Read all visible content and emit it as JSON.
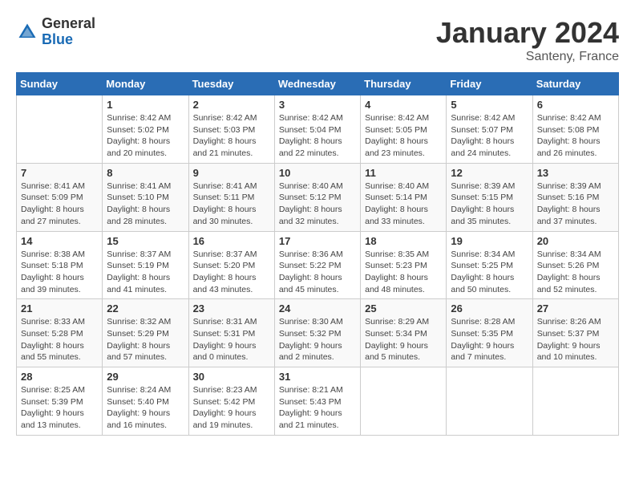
{
  "logo": {
    "general": "General",
    "blue": "Blue"
  },
  "title": "January 2024",
  "subtitle": "Santeny, France",
  "days_of_week": [
    "Sunday",
    "Monday",
    "Tuesday",
    "Wednesday",
    "Thursday",
    "Friday",
    "Saturday"
  ],
  "weeks": [
    [
      {
        "day": "",
        "sunrise": "",
        "sunset": "",
        "daylight": ""
      },
      {
        "day": "1",
        "sunrise": "Sunrise: 8:42 AM",
        "sunset": "Sunset: 5:02 PM",
        "daylight": "Daylight: 8 hours and 20 minutes."
      },
      {
        "day": "2",
        "sunrise": "Sunrise: 8:42 AM",
        "sunset": "Sunset: 5:03 PM",
        "daylight": "Daylight: 8 hours and 21 minutes."
      },
      {
        "day": "3",
        "sunrise": "Sunrise: 8:42 AM",
        "sunset": "Sunset: 5:04 PM",
        "daylight": "Daylight: 8 hours and 22 minutes."
      },
      {
        "day": "4",
        "sunrise": "Sunrise: 8:42 AM",
        "sunset": "Sunset: 5:05 PM",
        "daylight": "Daylight: 8 hours and 23 minutes."
      },
      {
        "day": "5",
        "sunrise": "Sunrise: 8:42 AM",
        "sunset": "Sunset: 5:07 PM",
        "daylight": "Daylight: 8 hours and 24 minutes."
      },
      {
        "day": "6",
        "sunrise": "Sunrise: 8:42 AM",
        "sunset": "Sunset: 5:08 PM",
        "daylight": "Daylight: 8 hours and 26 minutes."
      }
    ],
    [
      {
        "day": "7",
        "sunrise": "Sunrise: 8:41 AM",
        "sunset": "Sunset: 5:09 PM",
        "daylight": "Daylight: 8 hours and 27 minutes."
      },
      {
        "day": "8",
        "sunrise": "Sunrise: 8:41 AM",
        "sunset": "Sunset: 5:10 PM",
        "daylight": "Daylight: 8 hours and 28 minutes."
      },
      {
        "day": "9",
        "sunrise": "Sunrise: 8:41 AM",
        "sunset": "Sunset: 5:11 PM",
        "daylight": "Daylight: 8 hours and 30 minutes."
      },
      {
        "day": "10",
        "sunrise": "Sunrise: 8:40 AM",
        "sunset": "Sunset: 5:12 PM",
        "daylight": "Daylight: 8 hours and 32 minutes."
      },
      {
        "day": "11",
        "sunrise": "Sunrise: 8:40 AM",
        "sunset": "Sunset: 5:14 PM",
        "daylight": "Daylight: 8 hours and 33 minutes."
      },
      {
        "day": "12",
        "sunrise": "Sunrise: 8:39 AM",
        "sunset": "Sunset: 5:15 PM",
        "daylight": "Daylight: 8 hours and 35 minutes."
      },
      {
        "day": "13",
        "sunrise": "Sunrise: 8:39 AM",
        "sunset": "Sunset: 5:16 PM",
        "daylight": "Daylight: 8 hours and 37 minutes."
      }
    ],
    [
      {
        "day": "14",
        "sunrise": "Sunrise: 8:38 AM",
        "sunset": "Sunset: 5:18 PM",
        "daylight": "Daylight: 8 hours and 39 minutes."
      },
      {
        "day": "15",
        "sunrise": "Sunrise: 8:37 AM",
        "sunset": "Sunset: 5:19 PM",
        "daylight": "Daylight: 8 hours and 41 minutes."
      },
      {
        "day": "16",
        "sunrise": "Sunrise: 8:37 AM",
        "sunset": "Sunset: 5:20 PM",
        "daylight": "Daylight: 8 hours and 43 minutes."
      },
      {
        "day": "17",
        "sunrise": "Sunrise: 8:36 AM",
        "sunset": "Sunset: 5:22 PM",
        "daylight": "Daylight: 8 hours and 45 minutes."
      },
      {
        "day": "18",
        "sunrise": "Sunrise: 8:35 AM",
        "sunset": "Sunset: 5:23 PM",
        "daylight": "Daylight: 8 hours and 48 minutes."
      },
      {
        "day": "19",
        "sunrise": "Sunrise: 8:34 AM",
        "sunset": "Sunset: 5:25 PM",
        "daylight": "Daylight: 8 hours and 50 minutes."
      },
      {
        "day": "20",
        "sunrise": "Sunrise: 8:34 AM",
        "sunset": "Sunset: 5:26 PM",
        "daylight": "Daylight: 8 hours and 52 minutes."
      }
    ],
    [
      {
        "day": "21",
        "sunrise": "Sunrise: 8:33 AM",
        "sunset": "Sunset: 5:28 PM",
        "daylight": "Daylight: 8 hours and 55 minutes."
      },
      {
        "day": "22",
        "sunrise": "Sunrise: 8:32 AM",
        "sunset": "Sunset: 5:29 PM",
        "daylight": "Daylight: 8 hours and 57 minutes."
      },
      {
        "day": "23",
        "sunrise": "Sunrise: 8:31 AM",
        "sunset": "Sunset: 5:31 PM",
        "daylight": "Daylight: 9 hours and 0 minutes."
      },
      {
        "day": "24",
        "sunrise": "Sunrise: 8:30 AM",
        "sunset": "Sunset: 5:32 PM",
        "daylight": "Daylight: 9 hours and 2 minutes."
      },
      {
        "day": "25",
        "sunrise": "Sunrise: 8:29 AM",
        "sunset": "Sunset: 5:34 PM",
        "daylight": "Daylight: 9 hours and 5 minutes."
      },
      {
        "day": "26",
        "sunrise": "Sunrise: 8:28 AM",
        "sunset": "Sunset: 5:35 PM",
        "daylight": "Daylight: 9 hours and 7 minutes."
      },
      {
        "day": "27",
        "sunrise": "Sunrise: 8:26 AM",
        "sunset": "Sunset: 5:37 PM",
        "daylight": "Daylight: 9 hours and 10 minutes."
      }
    ],
    [
      {
        "day": "28",
        "sunrise": "Sunrise: 8:25 AM",
        "sunset": "Sunset: 5:39 PM",
        "daylight": "Daylight: 9 hours and 13 minutes."
      },
      {
        "day": "29",
        "sunrise": "Sunrise: 8:24 AM",
        "sunset": "Sunset: 5:40 PM",
        "daylight": "Daylight: 9 hours and 16 minutes."
      },
      {
        "day": "30",
        "sunrise": "Sunrise: 8:23 AM",
        "sunset": "Sunset: 5:42 PM",
        "daylight": "Daylight: 9 hours and 19 minutes."
      },
      {
        "day": "31",
        "sunrise": "Sunrise: 8:21 AM",
        "sunset": "Sunset: 5:43 PM",
        "daylight": "Daylight: 9 hours and 21 minutes."
      },
      {
        "day": "",
        "sunrise": "",
        "sunset": "",
        "daylight": ""
      },
      {
        "day": "",
        "sunrise": "",
        "sunset": "",
        "daylight": ""
      },
      {
        "day": "",
        "sunrise": "",
        "sunset": "",
        "daylight": ""
      }
    ]
  ]
}
